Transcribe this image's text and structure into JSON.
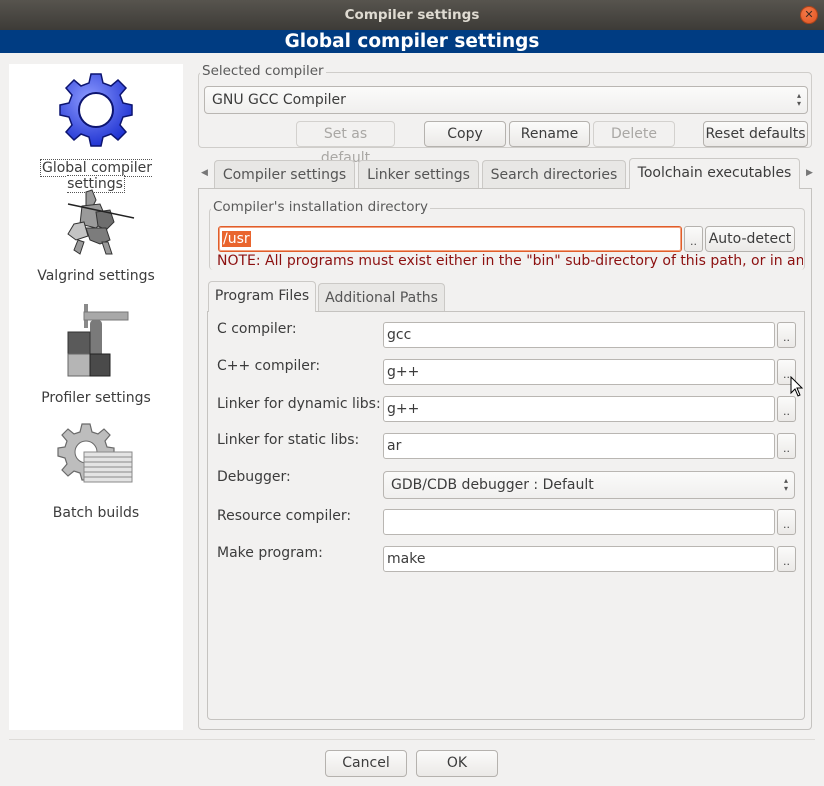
{
  "window": {
    "title": "Compiler settings",
    "close_icon": "close-icon"
  },
  "banner": {
    "title": "Global compiler settings"
  },
  "sidebar": {
    "items": [
      {
        "label": "Global compiler settings",
        "icon": "gear-icon",
        "selected": true
      },
      {
        "label": "Valgrind settings",
        "icon": "knight-icon",
        "selected": false
      },
      {
        "label": "Profiler settings",
        "icon": "caliper-icon",
        "selected": false
      },
      {
        "label": "Batch builds",
        "icon": "batch-gear-icon",
        "selected": false
      }
    ]
  },
  "selected_compiler": {
    "group_label": "Selected compiler",
    "value": "GNU GCC Compiler",
    "buttons": {
      "set_default": "Set as default",
      "copy": "Copy",
      "rename": "Rename",
      "delete": "Delete",
      "reset_defaults": "Reset defaults"
    }
  },
  "tabs": [
    {
      "label": "Compiler settings",
      "active": false
    },
    {
      "label": "Linker settings",
      "active": false
    },
    {
      "label": "Search directories",
      "active": false
    },
    {
      "label": "Toolchain executables",
      "active": true
    }
  ],
  "install_dir": {
    "group_label": "Compiler's installation directory",
    "value": "/usr",
    "browse_label": "..",
    "autodetect_label": "Auto-detect",
    "note": "NOTE: All programs must exist either in the \"bin\" sub-directory of this path, or in any"
  },
  "subtabs": [
    {
      "label": "Program Files",
      "active": true
    },
    {
      "label": "Additional Paths",
      "active": false
    }
  ],
  "program_files": {
    "browse_label": "..",
    "rows": [
      {
        "label": "C compiler:",
        "value": "gcc"
      },
      {
        "label": "C++ compiler:",
        "value": "g++"
      },
      {
        "label": "Linker for dynamic libs:",
        "value": "g++"
      },
      {
        "label": "Linker for static libs:",
        "value": "ar"
      },
      {
        "label": "Debugger:",
        "value": "GDB/CDB debugger : Default"
      },
      {
        "label": "Resource compiler:",
        "value": ""
      },
      {
        "label": "Make program:",
        "value": "make"
      }
    ]
  },
  "footer": {
    "cancel": "Cancel",
    "ok": "OK"
  },
  "colors": {
    "banner": "#003c82",
    "note_text": "#8c1010",
    "selection": "#e9652e"
  }
}
